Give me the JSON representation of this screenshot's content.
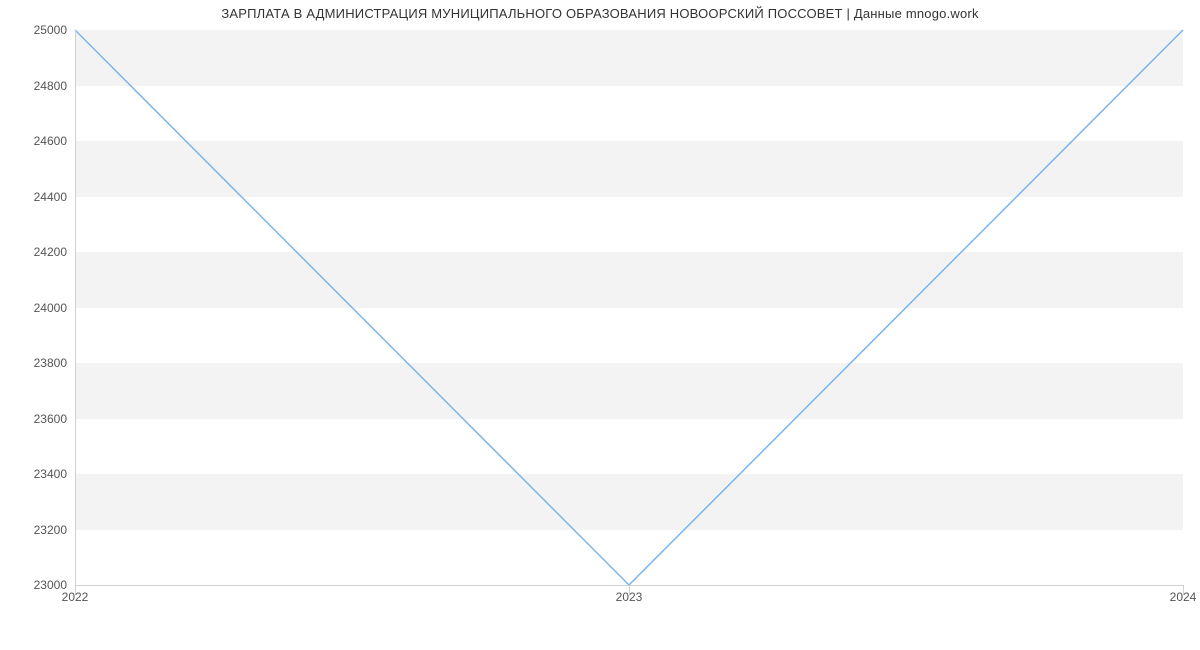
{
  "chart_data": {
    "type": "line",
    "title": "ЗАРПЛАТА В АДМИНИСТРАЦИЯ МУНИЦИПАЛЬНОГО ОБРАЗОВАНИЯ НОВООРСКИЙ ПОССОВЕТ | Данные mnogo.work",
    "x": [
      "2022",
      "2023",
      "2024"
    ],
    "values": [
      25000,
      23000,
      25000
    ],
    "xlabel": "",
    "ylabel": "",
    "ylim": [
      23000,
      25000
    ],
    "y_ticks": [
      23000,
      23200,
      23400,
      23600,
      23800,
      24000,
      24200,
      24400,
      24600,
      24800,
      25000
    ],
    "line_color": "#7cb5ec",
    "band_color": "#f3f3f3"
  }
}
